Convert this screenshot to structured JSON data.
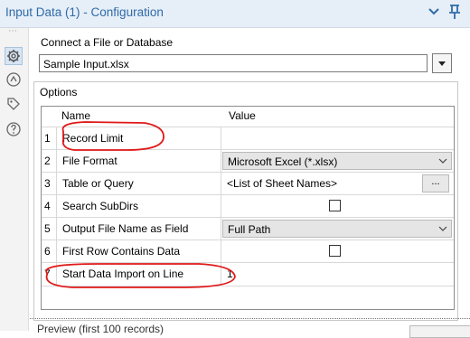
{
  "window": {
    "title": "Input Data (1) - Configuration"
  },
  "connect": {
    "label": "Connect a File or Database",
    "value": "Sample Input.xlsx"
  },
  "options": {
    "label": "Options",
    "headers": {
      "name": "Name",
      "value": "Value"
    },
    "rows": [
      {
        "num": "1",
        "name": "Record Limit",
        "value": ""
      },
      {
        "num": "2",
        "name": "File Format",
        "value": "Microsoft Excel (*.xlsx)"
      },
      {
        "num": "3",
        "name": "Table or Query",
        "value": "<List of Sheet Names>",
        "button": "..."
      },
      {
        "num": "4",
        "name": "Search SubDirs",
        "checked": false
      },
      {
        "num": "5",
        "name": "Output File Name as Field",
        "value": "Full Path"
      },
      {
        "num": "6",
        "name": "First Row Contains Data",
        "checked": false
      },
      {
        "num": "7",
        "name": "Start Data Import on Line",
        "value": "1"
      }
    ]
  },
  "preview": {
    "label": "Preview (first 100 records)"
  },
  "colors": {
    "accent_blue": "#2f6ba8",
    "annotation_red": "#e01818"
  },
  "icons": [
    "chevron-down-icon",
    "pin-icon",
    "gear-icon",
    "navigate-icon",
    "tag-icon",
    "help-icon"
  ]
}
